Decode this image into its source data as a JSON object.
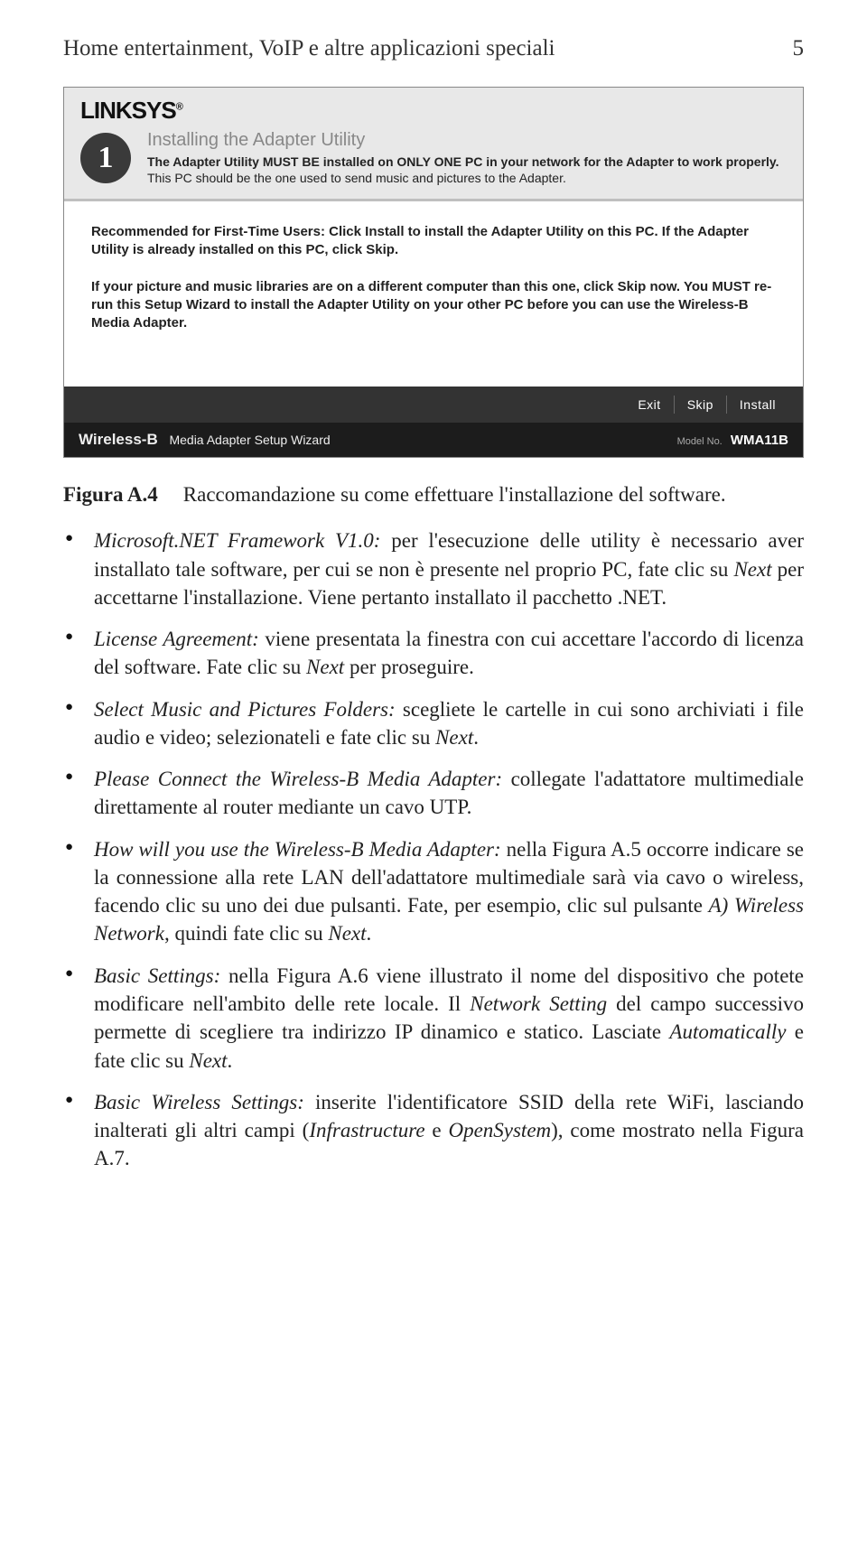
{
  "header": {
    "title": "Home entertainment, VoIP e altre applicazioni speciali",
    "pageNumber": "5"
  },
  "installer": {
    "logo": "LINKSYS",
    "logoReg": "®",
    "stepBadge": "1",
    "stepTitle": "Installing the Adapter Utility",
    "stepDescBold1": "The Adapter Utility MUST BE installed on ONLY ONE PC in your network for the Adapter to work properly.",
    "stepDescNormal": " This PC should be the one used to send music and pictures to the Adapter.",
    "body1_a": "Recommended for First-Time Users: Click ",
    "body1_b": "Install",
    "body1_c": " to install the Adapter Utility on this PC. If the Adapter Utility is already installed on this PC, click ",
    "body1_d": "Skip",
    "body1_e": ".",
    "body2_a": "If your picture and music libraries are on a different computer than this one, click ",
    "body2_b": "Skip",
    "body2_c": " now. You MUST re-run this Setup Wizard to install the Adapter Utility on your other PC before you can use the Wireless-B Media Adapter.",
    "footerButtons": [
      "Exit",
      "Skip",
      "Install"
    ],
    "bottomBarProduct": "Wireless-B",
    "bottomBarSub": "Media Adapter    Setup Wizard",
    "bottomBarModelLabel": "Model No.",
    "bottomBarModel": "WMA11B"
  },
  "figure": {
    "label": "Figura A.4",
    "caption": "Raccomandazione su come effettuare l'installazione del software."
  },
  "bullets": [
    {
      "runs": [
        {
          "t": "Microsoft.NET Framework V1.0:",
          "i": true
        },
        {
          "t": " per l'esecuzione delle utility è ne­cessario aver installato tale software, per cui se non è presente nel proprio PC, fate clic su "
        },
        {
          "t": "Next",
          "i": true
        },
        {
          "t": " per accettarne l'installazione. Viene pertanto installato il pacchetto .NET."
        }
      ]
    },
    {
      "runs": [
        {
          "t": "License Agreement:",
          "i": true
        },
        {
          "t": " viene presentata la finestra con cui accettare l'accordo di licenza del software. Fate clic su "
        },
        {
          "t": "Next",
          "i": true
        },
        {
          "t": " per proseguire."
        }
      ]
    },
    {
      "runs": [
        {
          "t": "Select Music and Pictures Folders:",
          "i": true
        },
        {
          "t": " scegliete le cartelle in cui sono archiviati i file audio e video; selezionateli e fate clic su "
        },
        {
          "t": "Next",
          "i": true
        },
        {
          "t": "."
        }
      ]
    },
    {
      "runs": [
        {
          "t": "Please Connect the Wireless-B Media Adapter:",
          "i": true
        },
        {
          "t": " collegate l'adattatore multimediale direttamente al router mediante un cavo UTP."
        }
      ]
    },
    {
      "runs": [
        {
          "t": "How will you use the Wireless-B Media Adapter:",
          "i": true
        },
        {
          "t": " nella Figura A.5 occorre indicare se la connessione alla rete LAN dell'adattatore multimediale sarà via cavo o wireless, facendo clic su uno dei due pulsanti. Fate, per esempio, clic sul pulsante "
        },
        {
          "t": "A) Wireless Network",
          "i": true
        },
        {
          "t": ", quindi fate clic su "
        },
        {
          "t": "Next",
          "i": true
        },
        {
          "t": "."
        }
      ]
    },
    {
      "runs": [
        {
          "t": "Basic Settings:",
          "i": true
        },
        {
          "t": " nella Figura A.6 viene illustrato il nome del disposi­tivo che potete modificare nell'ambito delle rete locale. Il "
        },
        {
          "t": "Network Setting",
          "i": true
        },
        {
          "t": " del campo successivo permette di scegliere tra indirizzo IP dinamico e statico. Lasciate "
        },
        {
          "t": "Automatically",
          "i": true
        },
        {
          "t": " e fate clic su "
        },
        {
          "t": "Next",
          "i": true
        },
        {
          "t": "."
        }
      ]
    },
    {
      "runs": [
        {
          "t": "Basic Wireless Settings:",
          "i": true
        },
        {
          "t": " inserite l'identificatore SSID della rete WiFi, lasciando inalterati gli altri campi ("
        },
        {
          "t": "Infrastructure",
          "i": true
        },
        {
          "t": " e "
        },
        {
          "t": "OpenSystem",
          "i": true
        },
        {
          "t": "), come mostrato nella Figura A.7."
        }
      ]
    }
  ]
}
